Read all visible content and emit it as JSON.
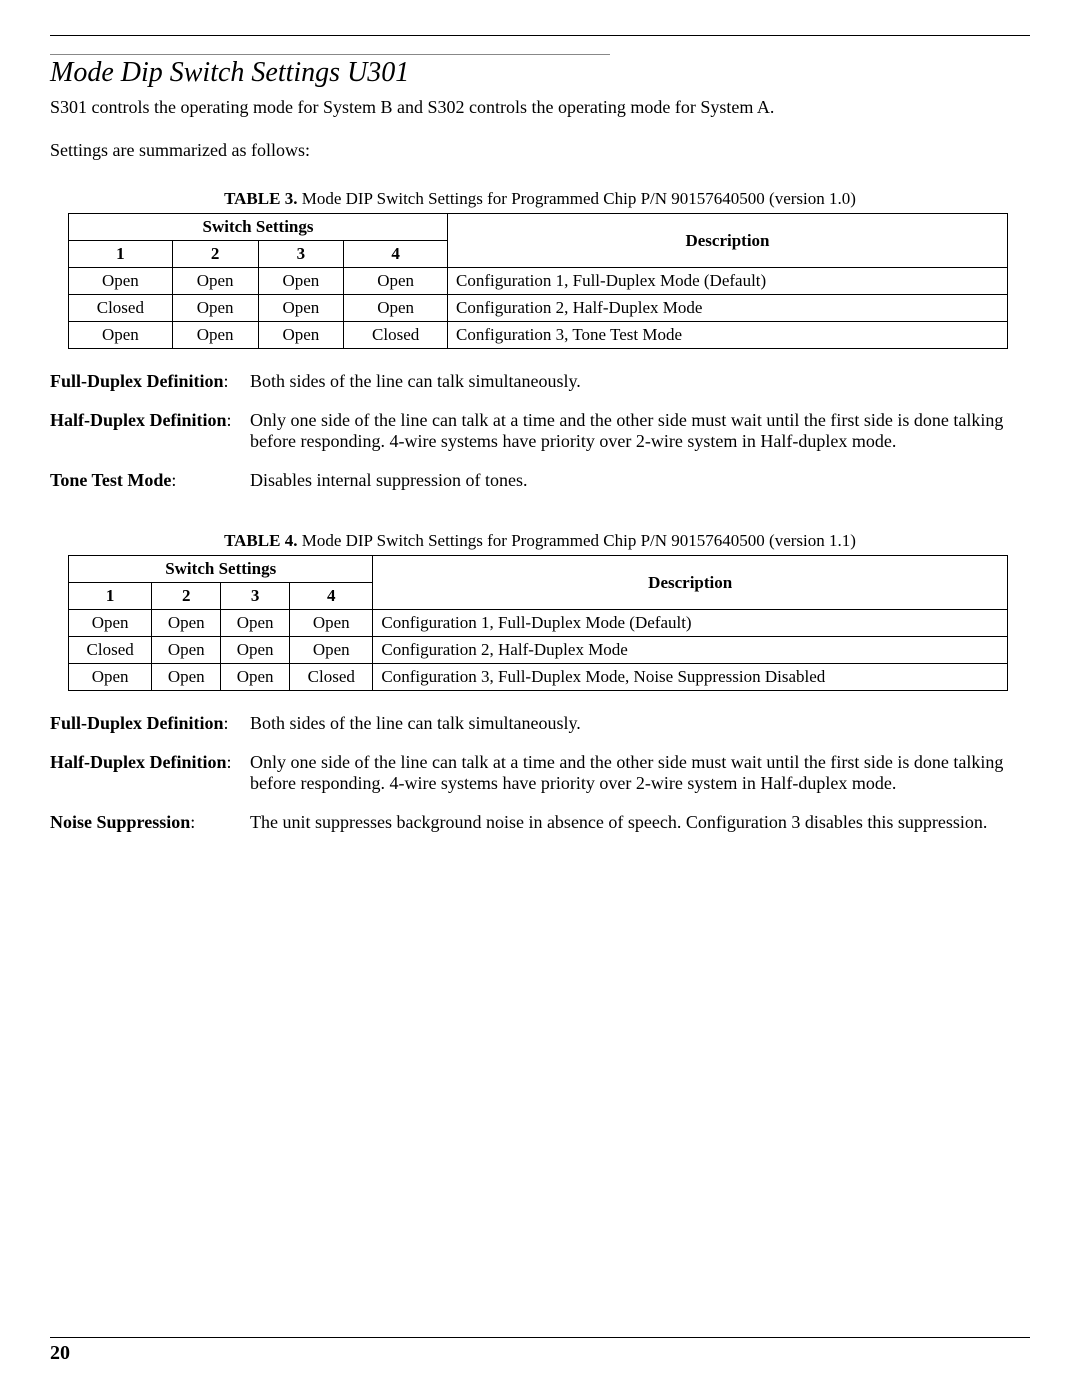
{
  "heading": "Mode Dip Switch Settings U301",
  "intro": "S301 controls the operating mode for System B and S302 controls the operating mode for System A.",
  "summary": "Settings are summarized as follows:",
  "table3": {
    "label": "TABLE 3.",
    "caption": "Mode DIP Switch Settings for Programmed Chip P/N 90157640500 (version 1.0)",
    "switch_header": "Switch Settings",
    "desc_header": "Description",
    "cols": [
      "1",
      "2",
      "3",
      "4"
    ],
    "rows": [
      {
        "s": [
          "Open",
          "Open",
          "Open",
          "Open"
        ],
        "desc": "Configuration 1, Full-Duplex Mode (Default)"
      },
      {
        "s": [
          "Closed",
          "Open",
          "Open",
          "Open"
        ],
        "desc": "Configuration 2, Half-Duplex Mode"
      },
      {
        "s": [
          "Open",
          "Open",
          "Open",
          "Closed"
        ],
        "desc": "Configuration 3, Tone Test Mode"
      }
    ]
  },
  "defs3": [
    {
      "term": "Full-Duplex Definition",
      "text": "Both sides of the line can talk simultaneously."
    },
    {
      "term": "Half-Duplex Definition",
      "text": "Only one side of the line can talk at a time and the other side must wait until the first side is done talking before responding. 4-wire systems have priority over 2-wire system in Half-duplex mode."
    },
    {
      "term": "Tone Test Mode",
      "text": "Disables internal suppression of tones."
    }
  ],
  "table4": {
    "label": "TABLE 4.",
    "caption": "Mode DIP Switch Settings for Programmed Chip P/N 90157640500 (version 1.1)",
    "switch_header": "Switch Settings",
    "desc_header": "Description",
    "cols": [
      "1",
      "2",
      "3",
      "4"
    ],
    "rows": [
      {
        "s": [
          "Open",
          "Open",
          "Open",
          "Open"
        ],
        "desc": "Configuration 1, Full-Duplex Mode (Default)"
      },
      {
        "s": [
          "Closed",
          "Open",
          "Open",
          "Open"
        ],
        "desc": "Configuration 2, Half-Duplex Mode"
      },
      {
        "s": [
          "Open",
          "Open",
          "Open",
          "Closed"
        ],
        "desc": "Configuration 3, Full-Duplex Mode, Noise Suppression Disabled"
      }
    ]
  },
  "defs4": [
    {
      "term": "Full-Duplex Definition",
      "text": "Both sides of the line can talk simultaneously."
    },
    {
      "term": "Half-Duplex Definition",
      "text": "Only one side of the line can talk at a time and the other side must wait until the first side is done talking before responding. 4-wire systems have priority over 2-wire system in Half-duplex mode."
    },
    {
      "term": "Noise Suppression",
      "text": "The unit suppresses background noise in absence of speech. Configuration 3 disables this suppression."
    }
  ],
  "page_number": "20"
}
